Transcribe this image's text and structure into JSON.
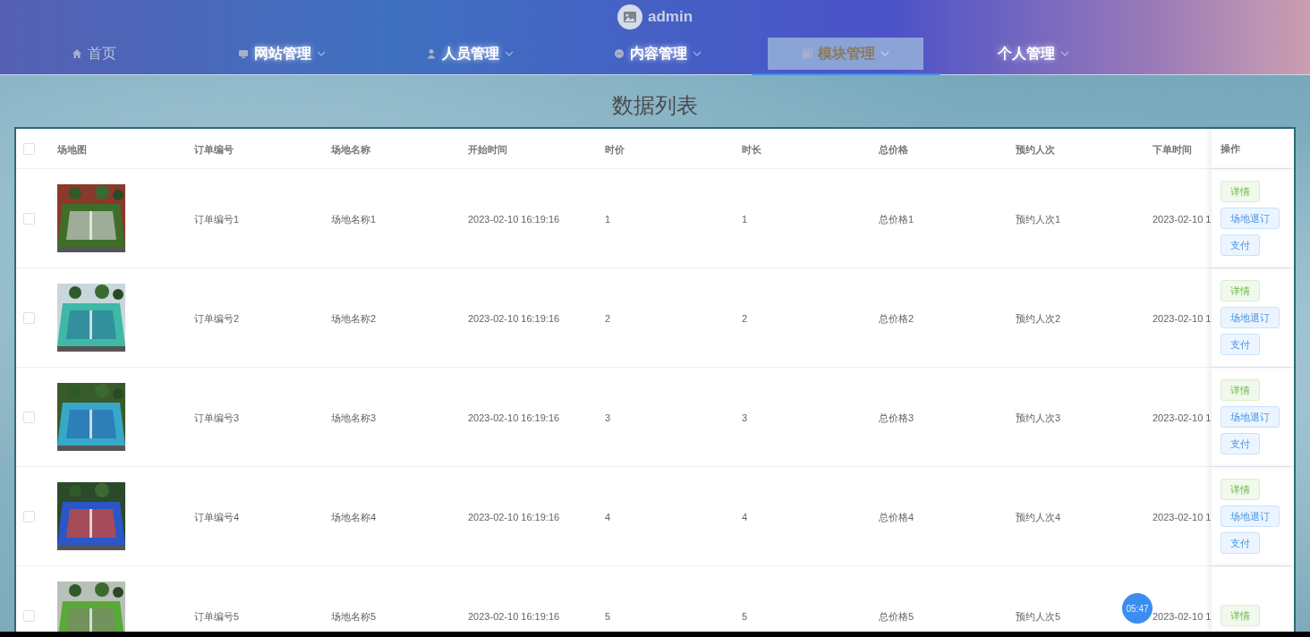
{
  "header": {
    "user": "admin"
  },
  "nav": [
    {
      "label": "首页",
      "dropdown": false,
      "selected": false
    },
    {
      "label": "网站管理",
      "dropdown": true,
      "selected": false
    },
    {
      "label": "人员管理",
      "dropdown": true,
      "selected": false
    },
    {
      "label": "内容管理",
      "dropdown": true,
      "selected": false
    },
    {
      "label": "模块管理",
      "dropdown": true,
      "selected": true
    },
    {
      "label": "个人管理",
      "dropdown": true,
      "selected": false
    }
  ],
  "title": "数据列表",
  "table": {
    "header_checked": false,
    "image_column": "场地图",
    "columns": [
      "订单编号",
      "场地名称",
      "开始时间",
      "时价",
      "时长",
      "总价格",
      "预约人次",
      "下单时间"
    ],
    "action_column": "操作",
    "rows": [
      {
        "checked": false,
        "cells": [
          "订单编号1",
          "场地名称1",
          "2023-02-10 16:19:16",
          "1",
          "1",
          "总价格1",
          "预约人次1",
          "2023-02-10 1"
        ],
        "actions": [
          {
            "label": "详情",
            "kind": "success"
          },
          {
            "label": "场地退订",
            "kind": "primary"
          },
          {
            "label": "支付",
            "kind": "primary"
          }
        ]
      },
      {
        "checked": false,
        "cells": [
          "订单编号2",
          "场地名称2",
          "2023-02-10 16:19:16",
          "2",
          "2",
          "总价格2",
          "预约人次2",
          "2023-02-10 1"
        ],
        "actions": [
          {
            "label": "详情",
            "kind": "success"
          },
          {
            "label": "场地退订",
            "kind": "primary"
          },
          {
            "label": "支付",
            "kind": "primary"
          }
        ]
      },
      {
        "checked": false,
        "cells": [
          "订单编号3",
          "场地名称3",
          "2023-02-10 16:19:16",
          "3",
          "3",
          "总价格3",
          "预约人次3",
          "2023-02-10 1"
        ],
        "actions": [
          {
            "label": "详情",
            "kind": "success"
          },
          {
            "label": "场地退订",
            "kind": "primary"
          },
          {
            "label": "支付",
            "kind": "primary"
          }
        ]
      },
      {
        "checked": false,
        "cells": [
          "订单编号4",
          "场地名称4",
          "2023-02-10 16:19:16",
          "4",
          "4",
          "总价格4",
          "预约人次4",
          "2023-02-10 1"
        ],
        "actions": [
          {
            "label": "详情",
            "kind": "success"
          },
          {
            "label": "场地退订",
            "kind": "primary"
          },
          {
            "label": "支付",
            "kind": "primary"
          }
        ]
      },
      {
        "checked": false,
        "cells": [
          "订单编号5",
          "场地名称5",
          "2023-02-10 16:19:16",
          "5",
          "5",
          "总价格5",
          "预约人次5",
          "2023-02-10 1"
        ],
        "actions": [
          {
            "label": "详情",
            "kind": "success"
          }
        ]
      }
    ]
  },
  "recording_timer": "05:47"
}
